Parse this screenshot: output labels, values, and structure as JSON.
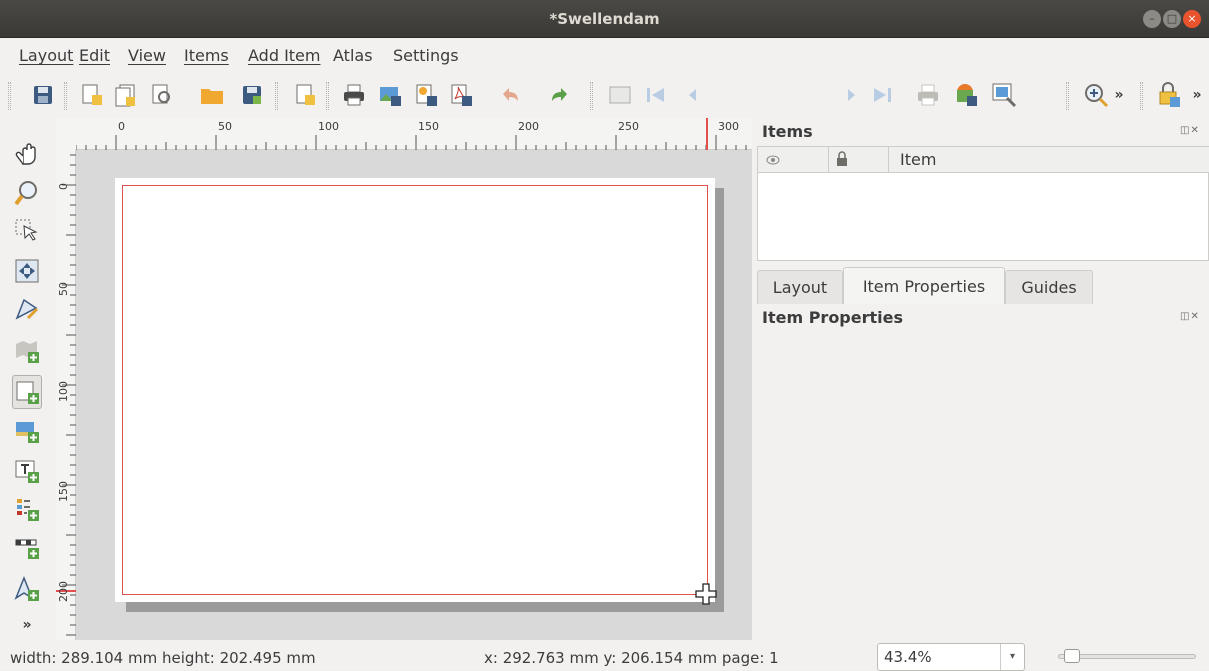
{
  "window": {
    "title": "*Swellendam",
    "controls": {
      "minimize": "–",
      "maximize": "□",
      "close": "×"
    }
  },
  "menubar": {
    "items": [
      "Layout",
      "Edit",
      "View",
      "Items",
      "Add Item",
      "Atlas",
      "Settings"
    ]
  },
  "toolbar": {
    "page_number": "1",
    "icons": [
      "save-layout-icon",
      "new-layout-icon",
      "duplicate-layout-icon",
      "layout-manager-icon",
      "open-folder-icon",
      "save-template-icon",
      "add-pages-icon",
      "print-icon",
      "export-image-icon",
      "export-svg-icon",
      "export-pdf-icon",
      "undo-icon",
      "redo-icon",
      "atlas-preview-icon",
      "first-feature-icon",
      "previous-feature-icon",
      "next-feature-icon",
      "last-feature-icon",
      "print-atlas-icon",
      "export-atlas-image-icon",
      "atlas-settings-icon",
      "zoom-in-icon",
      "lock-icon"
    ]
  },
  "left_tools": {
    "icons": [
      "pan-icon",
      "zoom-tool-icon",
      "select-move-icon",
      "move-content-icon",
      "edit-nodes-icon",
      "add-map-icon",
      "add-rectangle-icon",
      "add-picture-icon",
      "add-label-icon",
      "add-legend-icon",
      "add-scalebar-icon",
      "add-north-arrow-icon",
      "more-tools-icon"
    ]
  },
  "rulers": {
    "horizontal_labels": [
      "0",
      "50",
      "100",
      "150",
      "200",
      "250",
      "300"
    ],
    "vertical_labels": [
      "0",
      "50",
      "100",
      "150",
      "200"
    ]
  },
  "items_panel": {
    "title": "Items",
    "columns": {
      "visibility": "visibility-icon",
      "lock": "lock-icon",
      "item": "Item"
    }
  },
  "tabs": [
    "Layout",
    "Item Properties",
    "Guides"
  ],
  "properties_panel": {
    "title": "Item Properties"
  },
  "status": {
    "size": "width: 289.104 mm height: 202.495 mm",
    "position": "x: 292.763 mm  y: 206.154 mm  page: 1",
    "zoom": "43.4%"
  }
}
